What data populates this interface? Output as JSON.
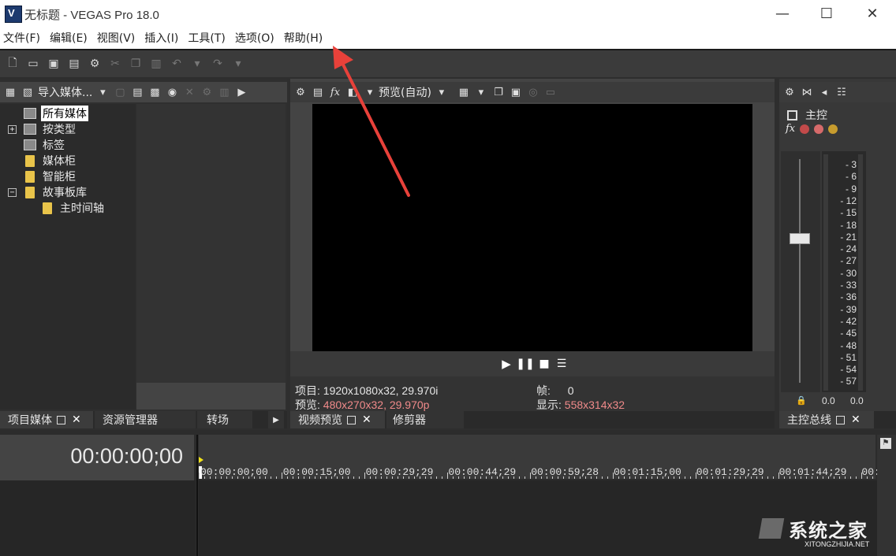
{
  "window": {
    "title": "无标题 - VEGAS Pro 18.0",
    "app_icon_letter": "V",
    "minimize": "—",
    "maximize": "☐",
    "close": "✕"
  },
  "menu": [
    {
      "label": "文件(F)"
    },
    {
      "label": "编辑(E)"
    },
    {
      "label": "视图(V)"
    },
    {
      "label": "插入(I)"
    },
    {
      "label": "工具(T)"
    },
    {
      "label": "选项(O)"
    },
    {
      "label": "帮助(H)"
    }
  ],
  "toolbar_icons": [
    "new-file-icon",
    "open-folder-icon",
    "save-icon",
    "render-icon",
    "settings-gear-icon",
    "cut-icon",
    "copy-icon",
    "paste-icon",
    "undo-icon",
    "dropdown-arrow-icon",
    "redo-icon",
    "dropdown-arrow-icon"
  ],
  "media_panel": {
    "import_label": "导入媒体...",
    "tree": [
      {
        "label": "所有媒体",
        "selected": true
      },
      {
        "label": "按类型"
      },
      {
        "label": "标签"
      },
      {
        "label": "媒体柜"
      },
      {
        "label": "智能柜"
      },
      {
        "label": "故事板库"
      },
      {
        "label": "主时间轴"
      }
    ],
    "tabs": [
      {
        "label": "项目媒体"
      },
      {
        "label": "资源管理器"
      },
      {
        "label": "转场"
      }
    ]
  },
  "preview_panel": {
    "preview_mode": "预览(自动)",
    "project_label": "项目:",
    "project_value": "1920x1080x32, 29.970i",
    "preview_label": "预览:",
    "preview_value": "480x270x32, 29.970p",
    "frame_label": "帧:",
    "frame_value": "0",
    "display_label": "显示:",
    "display_value": "558x314x32",
    "tabs": [
      {
        "label": "视频预览"
      },
      {
        "label": "修剪器"
      }
    ]
  },
  "master_panel": {
    "title": "主控",
    "meter_scale": [
      "3",
      "6",
      "9",
      "12",
      "15",
      "18",
      "21",
      "24",
      "27",
      "30",
      "33",
      "36",
      "39",
      "42",
      "45",
      "48",
      "51",
      "54",
      "57"
    ],
    "left_value": "0.0",
    "right_value": "0.0",
    "tab_label": "主控总线"
  },
  "timeline": {
    "timecode": "00:00:00;00",
    "ruler": [
      "00:00:00;00",
      "00:00:15;00",
      "00:00:29;29",
      "00:00:44;29",
      "00:00:59;28",
      "00:01:15;00",
      "00:01:29;29",
      "00:01:44;29",
      "00:0"
    ]
  },
  "watermark": {
    "text": "系统之家",
    "url": "XITONGZHIJIA.NET"
  },
  "colors": {
    "accent_red": "#e8413a",
    "pink_value": "#f08a8a",
    "folder_yellow": "#e9c44a",
    "playhead_yellow": "#f2e31a"
  }
}
